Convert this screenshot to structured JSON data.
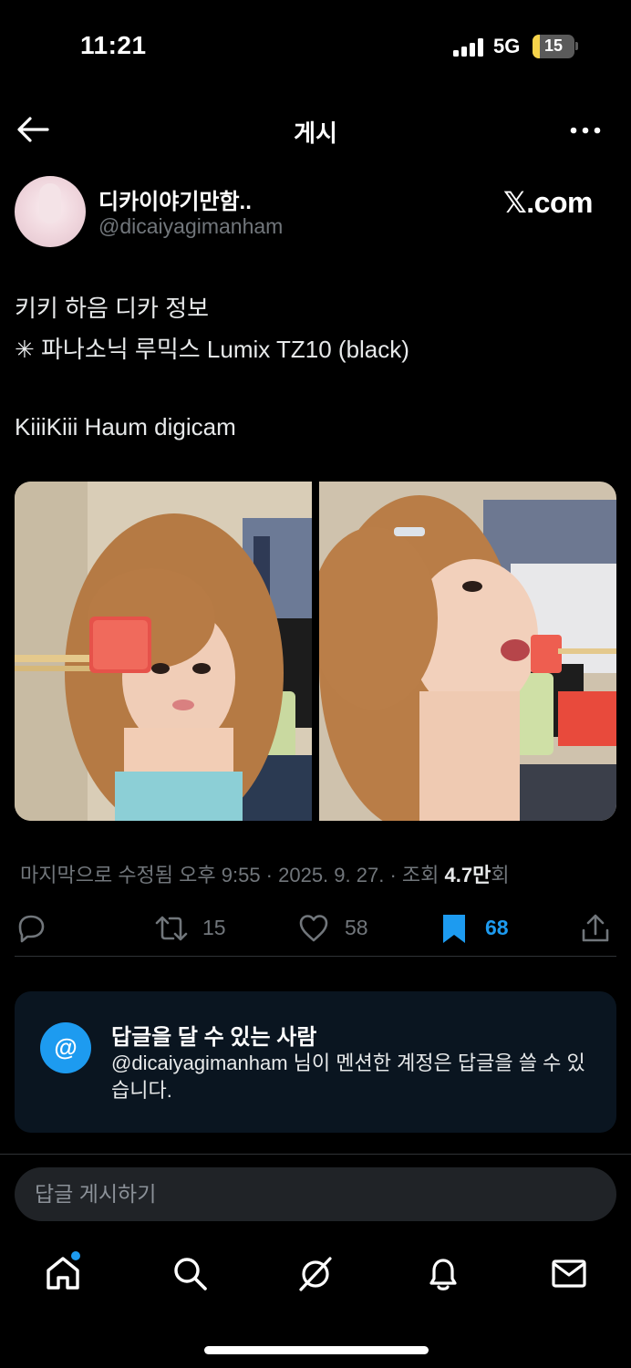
{
  "status_bar": {
    "time": "11:21",
    "network": "5G",
    "battery": "15",
    "battery_fraction": 0.15
  },
  "header": {
    "title": "게시"
  },
  "author": {
    "display_name": "디카이야기만함..",
    "handle": "@dicaiyagimanham"
  },
  "source_label": "𝕏.com",
  "post": {
    "lines": [
      "키키 하음 디카 정보",
      "✳ 파나소닉 루믹스 Lumix TZ10 (black)",
      "",
      "KiiiKiii Haum digicam"
    ]
  },
  "meta": {
    "edited": "마지막으로 수정됨 오후 9:55 · 2025. 9. 27.",
    "views_prefix": "· 조회",
    "views_count": "4.7만",
    "views_suffix": "회"
  },
  "actions": {
    "reposts": "15",
    "likes": "58",
    "bookmarks": "68"
  },
  "reply_restriction": {
    "badge": "@",
    "title": "답글을 달 수 있는 사람",
    "description": "@dicaiyagimanham 님이 멘션한 계정은 답글을 쓸 수 있습니다."
  },
  "reply_input": {
    "placeholder": "답글 게시하기"
  },
  "colors": {
    "accent": "#1d9bf0",
    "background": "#000000",
    "muted": "#71767b"
  },
  "icons": [
    "back-arrow-icon",
    "more-icon",
    "reply-icon",
    "repost-icon",
    "like-icon",
    "bookmark-icon",
    "share-icon",
    "home-icon",
    "search-icon",
    "grok-icon",
    "notifications-icon",
    "messages-icon"
  ]
}
